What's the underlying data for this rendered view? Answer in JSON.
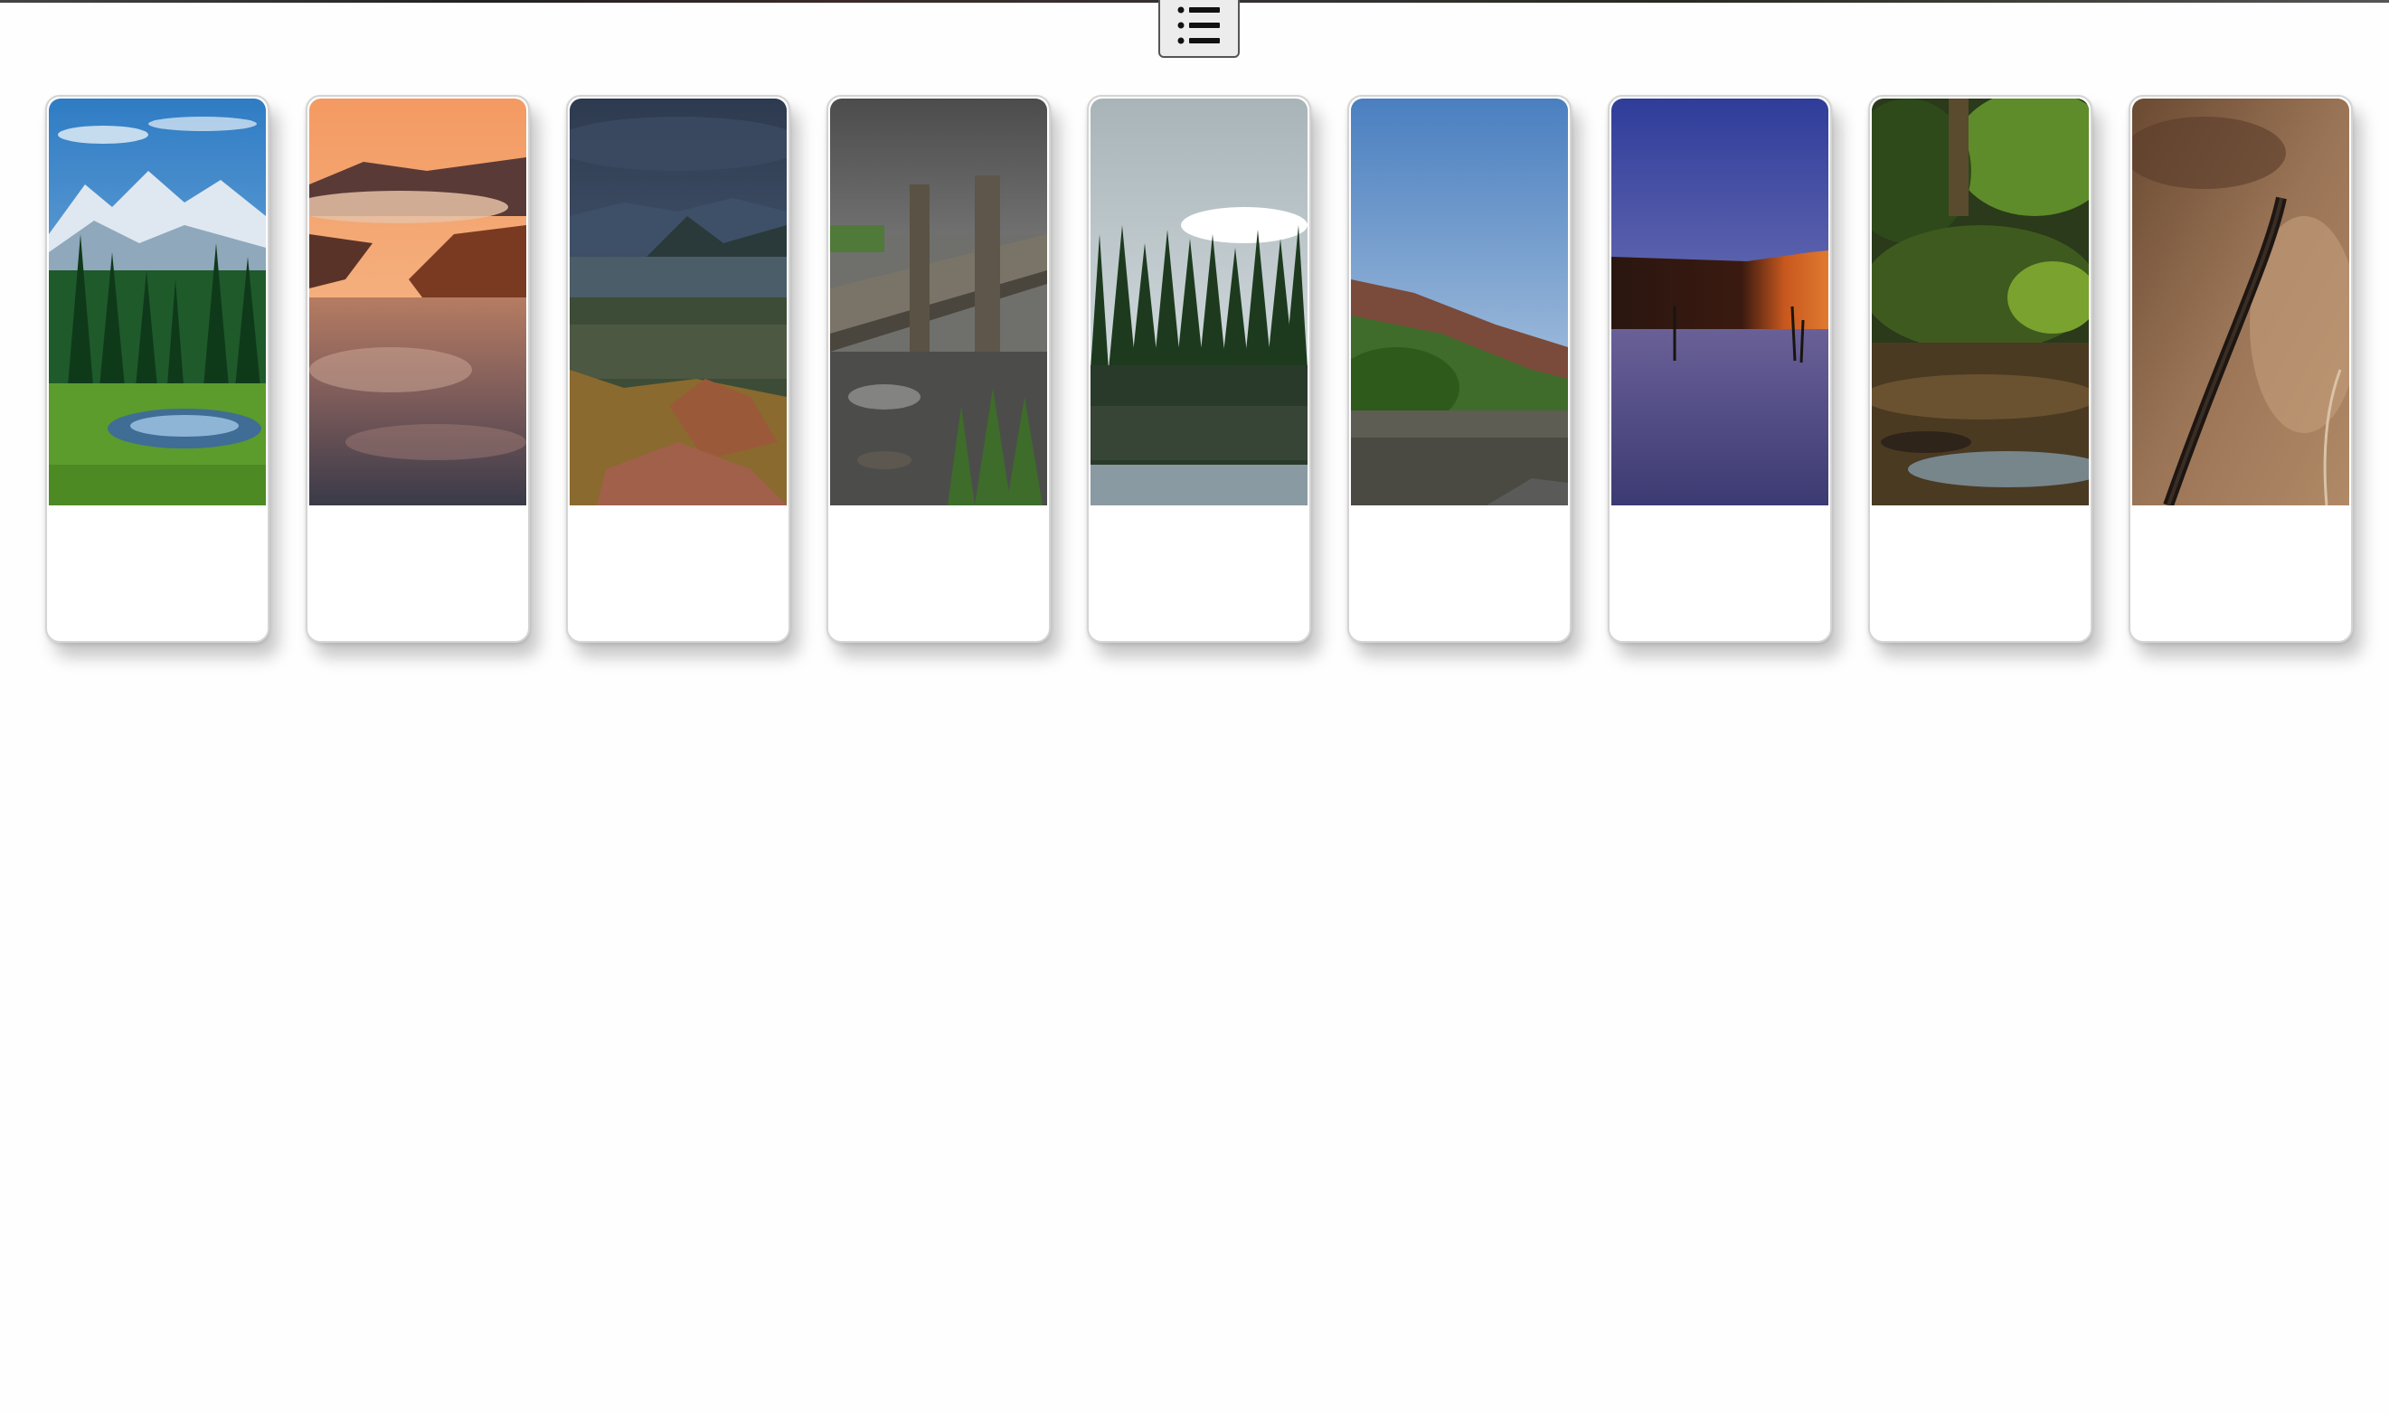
{
  "toolbar": {
    "menu_icon": "list-icon"
  },
  "gallery": {
    "cards": [
      {
        "scene": "alpine-meadow-lake",
        "caption": ""
      },
      {
        "scene": "sunset-sea-of-clouds",
        "caption": ""
      },
      {
        "scene": "lake-valley-overlook",
        "caption": ""
      },
      {
        "scene": "wooden-dock-stream",
        "caption": ""
      },
      {
        "scene": "forest-lake-reflection",
        "caption": ""
      },
      {
        "scene": "hillside-lake-dusk",
        "caption": ""
      },
      {
        "scene": "desert-dune-twilight",
        "caption": ""
      },
      {
        "scene": "forest-creek",
        "caption": ""
      },
      {
        "scene": "aerial-road-desert",
        "caption": ""
      }
    ]
  }
}
